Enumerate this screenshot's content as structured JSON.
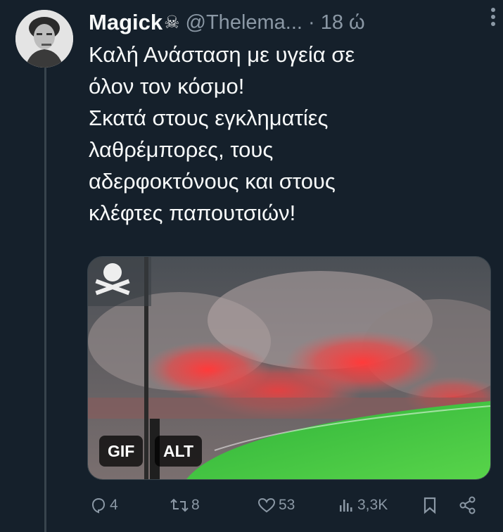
{
  "tweet": {
    "author_name": "Magick",
    "name_icon": "skull-crossbones-icon",
    "name_glyph": "☠",
    "handle": "@Thelema...",
    "timestamp": "· 18 ώ",
    "text_lines": [
      "Καλή Ανάσταση με υγεία σε",
      "όλον τον κόσμο!",
      "Σκατά στους εγκληματίες",
      "λαθρέμπορες, τους",
      "αδερφοκτόνους και στους",
      "κλέφτες παπουτσιών!"
    ]
  },
  "media": {
    "gif_badge": "GIF",
    "alt_badge": "ALT"
  },
  "actions": {
    "replies": "4",
    "reposts": "8",
    "likes": "53",
    "views": "3,3K"
  },
  "colors": {
    "background": "#15202b",
    "secondary_text": "#8b98a5"
  }
}
